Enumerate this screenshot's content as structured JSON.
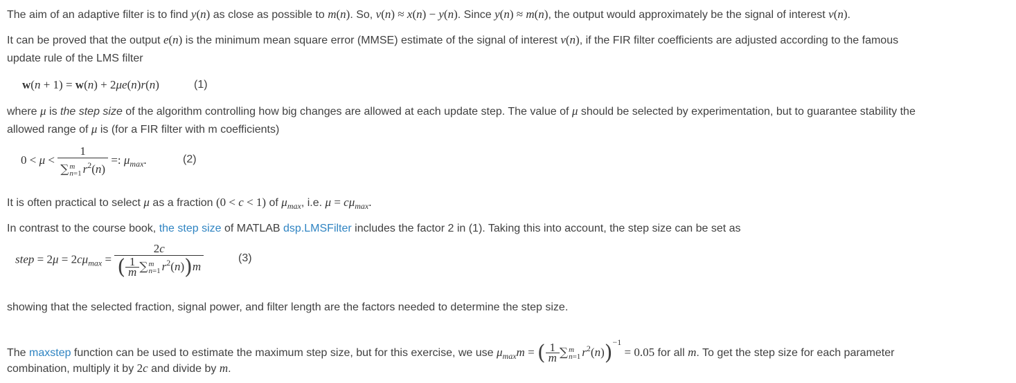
{
  "p1": {
    "t1": "The aim of an adaptive filter is to find ",
    "t2": " as close as possible to ",
    "t3": ". So, ",
    "t4": ". Since ",
    "t5": ", the output would approximately be the signal of interest ",
    "t6": "."
  },
  "p2": {
    "t1": "It can be proved that the output ",
    "t2": " is the minimum mean square error (MMSE) estimate of the signal of interest ",
    "t3": ", if the FIR filter coefficients are adjusted according to the famous",
    "t4": "update rule of the LMS filter"
  },
  "eq1": {
    "number": "(1)"
  },
  "p3": {
    "t1": "where ",
    "t2": " is ",
    "em": "the step size",
    "t3": " of the algorithm controlling how big changes are allowed at each update step. The value of ",
    "t4": " should be selected by experimentation, but to guarantee stability the",
    "t5": "allowed range of ",
    "t6": " is (for a FIR filter with m coefficients)"
  },
  "eq2": {
    "number": "(2)"
  },
  "p4": {
    "t1": "It is often practical to select ",
    "t2": " as a fraction ",
    "t3": " of ",
    "t4": ", i.e. "
  },
  "p5": {
    "t1": "In contrast to the course book, ",
    "link1": "the step size",
    "t2": " of MATLAB ",
    "link2": "dsp.LMSFilter",
    "t3": " includes the factor 2 in (1). Taking this into account, the step size can be set as"
  },
  "eq3": {
    "number": "(3)"
  },
  "p6": {
    "t1": "showing that the selected fraction, signal power, and filter length are the factors needed to determine the step size."
  },
  "p7": {
    "t1": "The ",
    "link": "maxstep",
    "t2": " function can be used to estimate the maximum step size, but for this exercise, we use ",
    "t3": " for all ",
    "t4": ". To get the step size for each parameter",
    "t5": "combination, multiply it by ",
    "t6": " and divide by ",
    "t7": "."
  }
}
